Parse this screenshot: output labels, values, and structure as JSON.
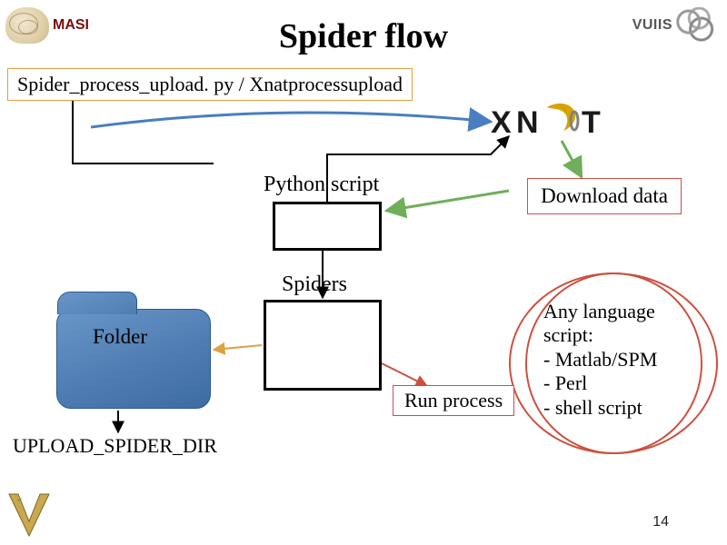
{
  "title": "Spider flow",
  "logos": {
    "masi_text": "MASI",
    "vuiis_text": "VUIIS"
  },
  "file_box": "Spider_process_upload. py / Xnatprocessupload",
  "labels": {
    "python_script": "Python script",
    "spiders": "Spiders",
    "folder": "Folder",
    "upload_dir": "UPLOAD_SPIDER_DIR"
  },
  "download_box": "Download data",
  "run_process": "Run process",
  "any_language": {
    "l1": "Any language",
    "l2": "script:",
    "l3": " - Matlab/SPM",
    "l4": " - Perl",
    "l5": " - shell script"
  },
  "page_number": "14",
  "colors": {
    "orange_border": "#e0a040",
    "red_border": "#cc5040",
    "folder_fill": "#4f7db3"
  },
  "xnat": {
    "brand": "XNAT"
  }
}
